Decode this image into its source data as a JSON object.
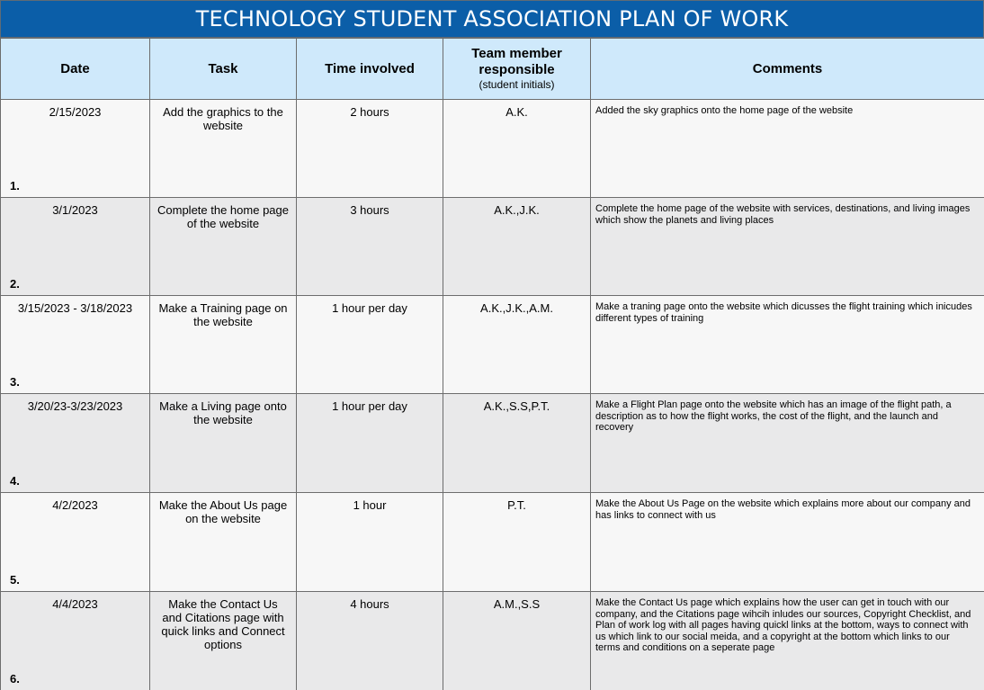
{
  "title": "TECHNOLOGY STUDENT ASSOCIATION PLAN OF WORK",
  "headers": {
    "date": "Date",
    "task": "Task",
    "time": "Time involved",
    "team": "Team member responsible",
    "team_sub": "(student initials)",
    "comments": "Comments"
  },
  "rows": [
    {
      "num": "1.",
      "date": "2/15/2023",
      "task": "Add the graphics to the website",
      "time": "2 hours",
      "team": "A.K.",
      "comments": "Added the sky graphics onto the home page of the website"
    },
    {
      "num": "2.",
      "date": "3/1/2023",
      "task": "Complete the home page of the website",
      "time": "3 hours",
      "team": "A.K.,J.K.",
      "comments": "Complete the home page of the website with services, destinations, and living images which show the planets and living places"
    },
    {
      "num": "3.",
      "date": "3/15/2023 - 3/18/2023",
      "task": "Make a Training page on the website",
      "time": "1 hour per day",
      "team": "A.K.,J.K.,A.M.",
      "comments": "Make a traning page onto the website which dicusses the flight training which inicudes different types of training"
    },
    {
      "num": "4.",
      "date": "3/20/23-3/23/2023",
      "task": "Make a Living page onto the website",
      "time": "1 hour per day",
      "team": "A.K.,S.S,P.T.",
      "comments": "Make a Flight Plan page onto the website which has an image of the flight path, a description as to how the flight works, the cost of the flight, and the launch and recovery"
    },
    {
      "num": "5.",
      "date": "4/2/2023",
      "task": "Make the About Us page on the website",
      "time": "1 hour",
      "team": "P.T.",
      "comments": "Make the About Us Page on the website which explains more about our company and has links to connect with us"
    },
    {
      "num": "6.",
      "date": "4/4/2023",
      "task": "Make the Contact Us and Citations page with quick links and Connect options",
      "time": "4 hours",
      "team": "A.M.,S.S",
      "comments": "Make the Contact Us page which explains how the user can get in touch with our company, and the Citations page wihcih inludes our sources, Copyright Checklist, and Plan of work log with all pages having quickl links at the bottom, ways to connect with us which link to our social meida, and a copyright at the bottom which links to our terms and conditions on a seperate page"
    }
  ]
}
